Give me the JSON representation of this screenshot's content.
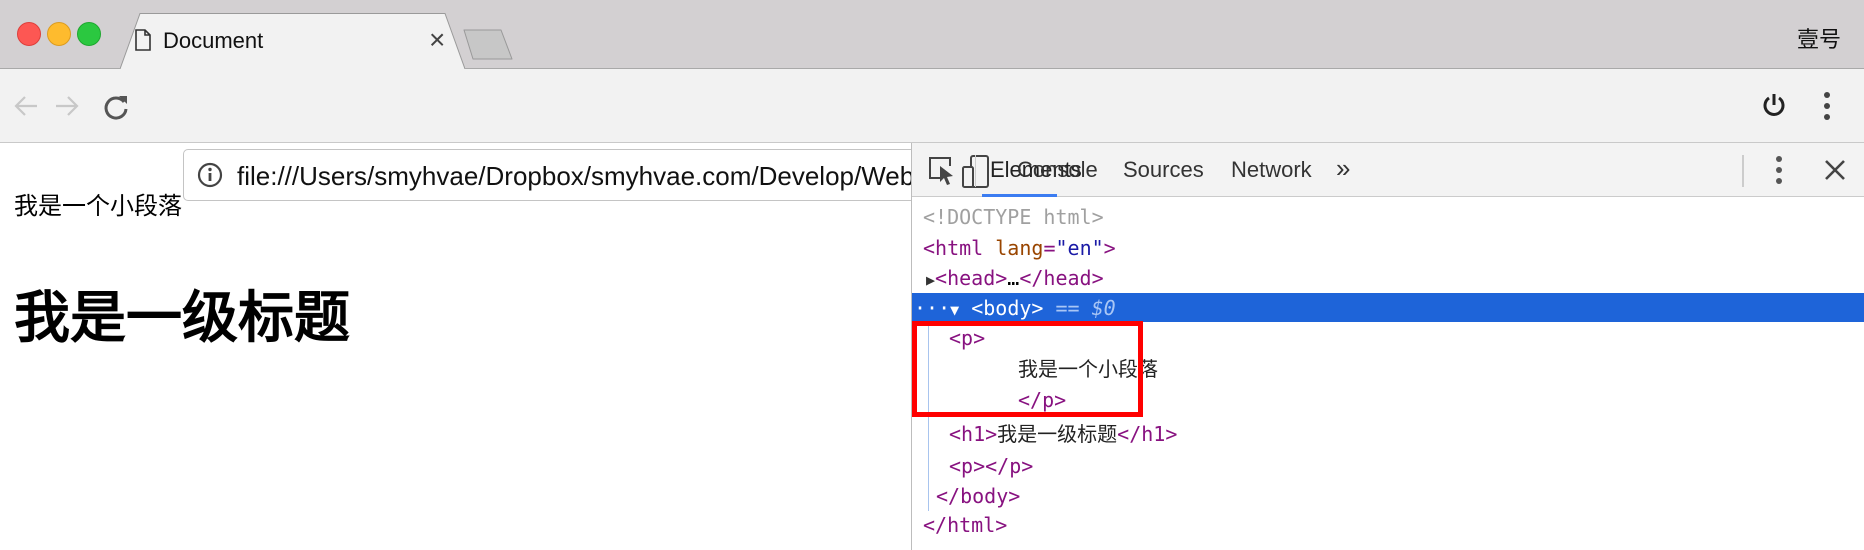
{
  "window": {
    "user_label": "壹号",
    "traffic_lights": {
      "close": "#fd5753",
      "minimize": "#febb2e",
      "zoom": "#2bc840"
    }
  },
  "tab": {
    "title": "Document",
    "icon": "document-icon",
    "close": "×"
  },
  "toolbar": {
    "url": "file:///Users/smyhvae/Dropbox/smyhvae.com/Develop/Web/Test/test.html"
  },
  "page": {
    "paragraph": "我是一个小段落",
    "heading": "我是一级标题"
  },
  "devtools": {
    "tabs": [
      "Elements",
      "Console",
      "Sources",
      "Network"
    ],
    "active_tab": "Elements",
    "more": "»",
    "accent": "#1e64d9",
    "tree": {
      "doctype": "<!DOCTYPE html>",
      "html_open": "<html",
      "lang_attr": "lang",
      "lang_val": "\"en\"",
      "head": "<head>",
      "ellipsis": "…",
      "head_close": "</head>",
      "body": "<body>",
      "selected_marker": "== $0",
      "dots": "···",
      "p_open": "<p>",
      "p_text": "我是一个小段落",
      "p_close": "</p>",
      "h1_open": "<h1>",
      "h1_text": "我是一级标题",
      "h1_close": "</h1>",
      "empty_p": "<p></p>",
      "body_close": "</body>",
      "html_close": "</html>"
    }
  }
}
